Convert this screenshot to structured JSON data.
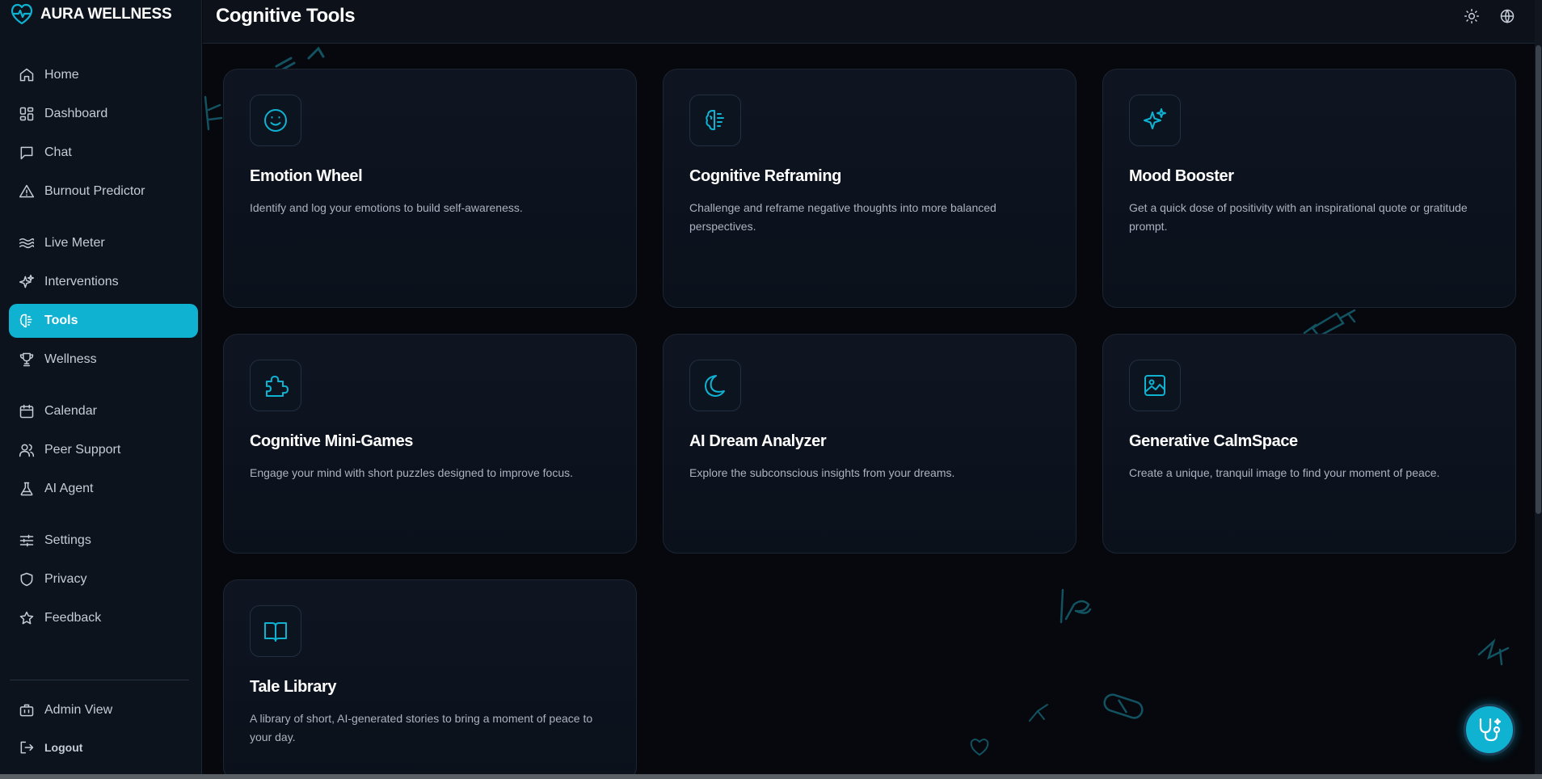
{
  "brand": {
    "name": "AURA WELLNESS",
    "icon": "heart-pulse-icon",
    "accent": "#0fb2d1"
  },
  "sidebar": {
    "items": [
      {
        "label": "Home",
        "icon": "home-icon"
      },
      {
        "label": "Dashboard",
        "icon": "dashboard-icon"
      },
      {
        "label": "Chat",
        "icon": "chat-icon"
      },
      {
        "label": "Burnout Predictor",
        "icon": "warning-icon"
      },
      {
        "label": "Live Meter",
        "icon": "waves-icon"
      },
      {
        "label": "Interventions",
        "icon": "sparkles-icon"
      },
      {
        "label": "Tools",
        "icon": "brain-icon",
        "active": true
      },
      {
        "label": "Wellness",
        "icon": "trophy-icon"
      },
      {
        "label": "Calendar",
        "icon": "calendar-icon"
      },
      {
        "label": "Peer Support",
        "icon": "users-icon"
      },
      {
        "label": "AI Agent",
        "icon": "flask-icon"
      },
      {
        "label": "Settings",
        "icon": "sliders-icon"
      },
      {
        "label": "Privacy",
        "icon": "shield-icon"
      },
      {
        "label": "Feedback",
        "icon": "star-icon"
      }
    ],
    "footer": [
      {
        "label": "Admin View",
        "icon": "briefcase-icon"
      },
      {
        "label": "Logout",
        "icon": "logout-icon"
      }
    ]
  },
  "header": {
    "title": "Cognitive Tools",
    "actions": [
      {
        "icon": "sun-icon"
      },
      {
        "icon": "globe-icon"
      }
    ]
  },
  "tools": [
    {
      "title": "Emotion Wheel",
      "description": "Identify and log your emotions to build self-awareness.",
      "icon": "smile-icon"
    },
    {
      "title": "Cognitive Reframing",
      "description": "Challenge and reframe negative thoughts into more balanced perspectives.",
      "icon": "brain-icon"
    },
    {
      "title": "Mood Booster",
      "description": "Get a quick dose of positivity with an inspirational quote or gratitude prompt.",
      "icon": "sparkles-icon"
    },
    {
      "title": "Cognitive Mini-Games",
      "description": "Engage your mind with short puzzles designed to improve focus.",
      "icon": "puzzle-icon"
    },
    {
      "title": "AI Dream Analyzer",
      "description": "Explore the subconscious insights from your dreams.",
      "icon": "moon-icon"
    },
    {
      "title": "Generative CalmSpace",
      "description": "Create a unique, tranquil image to find your moment of peace.",
      "icon": "image-icon"
    },
    {
      "title": "Tale Library",
      "description": "A library of short, AI-generated stories to bring a moment of peace to your day.",
      "icon": "book-icon"
    }
  ],
  "fab": {
    "icon": "stethoscope-icon"
  }
}
